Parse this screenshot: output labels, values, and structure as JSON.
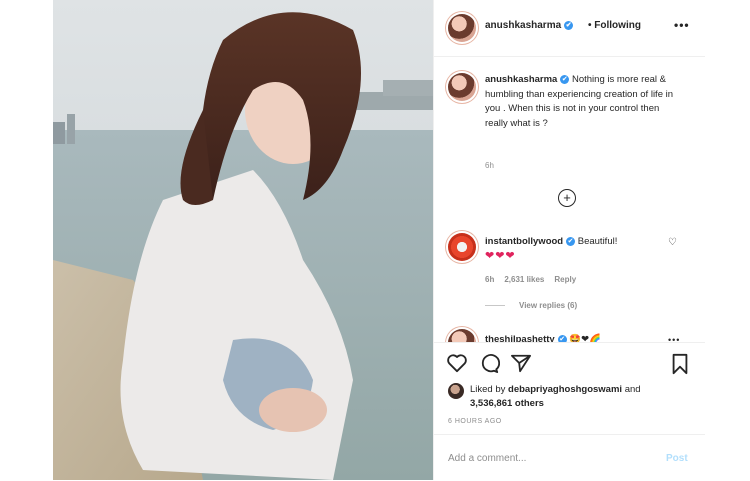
{
  "header": {
    "username": "anushkasharma",
    "verified_mark": "✔",
    "following_label": "• Following",
    "more_icon": "more-horizontal-icon",
    "more_glyph": "•••"
  },
  "caption": {
    "username": "anushkasharma",
    "text": " Nothing is more real & humbling than experiencing creation of life in you . When this is not in your control then really what is ?",
    "time": "6h"
  },
  "load_more_glyph": "+",
  "comments": [
    {
      "username": "instantbollywood",
      "text": " Beautiful!",
      "emoji": "❤❤❤",
      "time": "6h",
      "likes": "2,631 likes",
      "reply": "Reply",
      "view_replies": "View replies (6)"
    },
    {
      "username": "theshilpashetty",
      "text": " 🤩❤🌈"
    }
  ],
  "actions": {
    "like_icon": "heart-icon",
    "comment_icon": "comment-icon",
    "share_icon": "paper-plane-icon",
    "save_icon": "bookmark-icon"
  },
  "likes": {
    "prefix": "Liked by ",
    "user": "debapriyaghoshgoswami",
    "middle": " and",
    "count": "3,536,861 others"
  },
  "posted_ago": "6 HOURS AGO",
  "add_comment": {
    "placeholder": "Add a comment...",
    "post_label": "Post"
  },
  "colors": {
    "verified": "#3897f0",
    "muted": "#8e8e8e",
    "text": "#262626",
    "post_disabled": "#b2dffc"
  }
}
